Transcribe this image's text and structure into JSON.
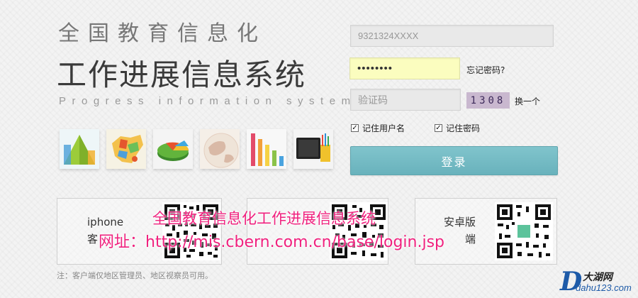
{
  "title": {
    "line1": "全国教育信息化",
    "line2": "工作进展信息系统",
    "subtitle": "Progress information system"
  },
  "thumbnails": [
    {
      "name": "pyramid-chart-thumbnail"
    },
    {
      "name": "china-map-thumbnail"
    },
    {
      "name": "pie-chart-thumbnail"
    },
    {
      "name": "globe-thumbnail"
    },
    {
      "name": "bar-chart-thumbnail"
    },
    {
      "name": "tablet-pencils-thumbnail"
    }
  ],
  "form": {
    "username_value": "9321324XXXX",
    "password_value": "••••••••",
    "forgot_password": "忘记密码?",
    "captcha_placeholder": "验证码",
    "captcha_image_text": "1308",
    "captcha_refresh": "换一个",
    "remember_username": "记住用户名",
    "remember_password": "记住密码",
    "login_button": "登录"
  },
  "apps": {
    "iphone_label_line1": "iphone",
    "iphone_label_line2": "客",
    "android_label_line1": "安卓版",
    "android_label_line2": "端"
  },
  "overlay": {
    "line1": "全国教育信息化工作进展信息系统",
    "line2": "网址：http://mis.cbern.com.cn/base/login.jsp"
  },
  "footnote": "注：客户端仅地区管理员、地区视察员可用。",
  "logo": {
    "name": "大湖网",
    "url": "dahu123.com",
    "mark": "D"
  },
  "colors": {
    "login_button": "#6fb7c1",
    "password_field_bg": "#fbfdbf",
    "overlay_text": "#f0217e",
    "captcha_bg": "#c9b8cf"
  }
}
